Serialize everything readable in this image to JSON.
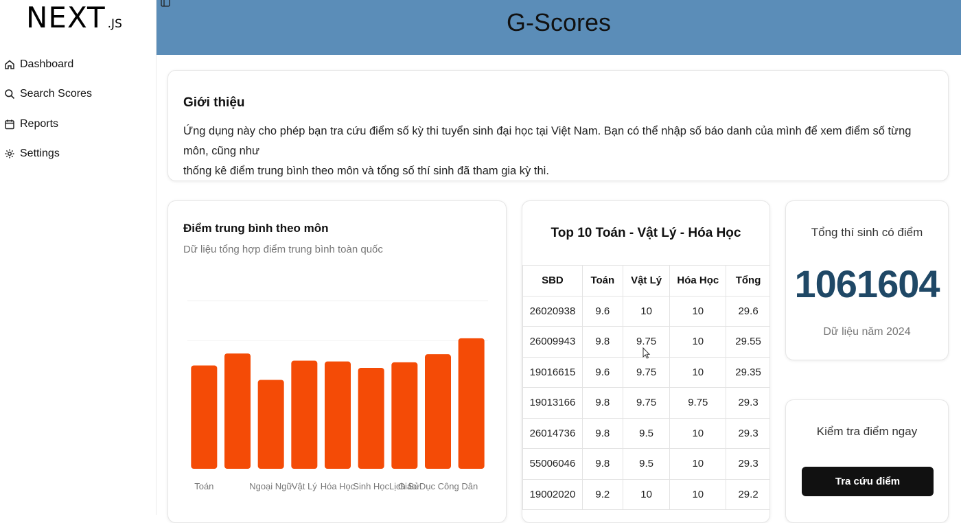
{
  "sidebar": {
    "logo": "NEXT",
    "logo_suffix": ".JS",
    "items": [
      {
        "label": "Dashboard",
        "icon": "home-icon"
      },
      {
        "label": "Search Scores",
        "icon": "search-icon"
      },
      {
        "label": "Reports",
        "icon": "calendar-icon"
      },
      {
        "label": "Settings",
        "icon": "gear-icon"
      }
    ]
  },
  "header": {
    "title": "G-Scores"
  },
  "intro": {
    "title": "Giới thiệu",
    "text_line1": "Ứng dụng này cho phép bạn tra cứu điểm số kỳ thi tuyển sinh đại học tại Việt Nam. Bạn có thể nhập số báo danh của mình để xem điểm số từng môn, cũng như",
    "text_line2": "thống kê điểm trung bình theo môn và tổng số thí sinh đã tham gia kỳ thi."
  },
  "chart_card": {
    "title": "Điểm trung bình theo môn",
    "subtitle": "Dữ liệu tổng hợp điểm trung bình toàn quốc"
  },
  "chart_data": {
    "type": "bar",
    "categories": [
      "Toán",
      "Ngữ Văn",
      "Ngoại Ngữ",
      "Vật Lý",
      "Hóa Học",
      "Sinh Học",
      "Lịch Sử",
      "Giáo Dục Công Dân"
    ],
    "visible_tick_labels": [
      "Toán",
      "",
      "Ngoại Ngữ",
      "Vật Lý",
      "Hóa Học",
      "Sinh Học",
      "Lịch Sử",
      "Giáo Dục Công Dân"
    ],
    "values": [
      6.45,
      7.2,
      5.55,
      6.75,
      6.7,
      6.3,
      6.65,
      7.15,
      8.15
    ],
    "ylim": [
      0,
      12
    ],
    "bar_color": "#f44b06",
    "grid": true,
    "title": "",
    "xlabel": "",
    "ylabel": ""
  },
  "top_table": {
    "title": "Top 10 Toán - Vật Lý - Hóa Học",
    "headers": [
      "SBD",
      "Toán",
      "Vật Lý",
      "Hóa Học",
      "Tổng"
    ],
    "rows": [
      [
        "26020938",
        "9.6",
        "10",
        "10",
        "29.6"
      ],
      [
        "26009943",
        "9.8",
        "9.75",
        "10",
        "29.55"
      ],
      [
        "19016615",
        "9.6",
        "9.75",
        "10",
        "29.35"
      ],
      [
        "19013166",
        "9.8",
        "9.75",
        "9.75",
        "29.3"
      ],
      [
        "26014736",
        "9.8",
        "9.5",
        "10",
        "29.3"
      ],
      [
        "55006046",
        "9.8",
        "9.5",
        "10",
        "29.3"
      ],
      [
        "19002020",
        "9.2",
        "10",
        "10",
        "29.2"
      ]
    ]
  },
  "total": {
    "label": "Tổng thí sinh có điểm",
    "value": "1061604",
    "year_note": "Dữ liệu năm 2024"
  },
  "check": {
    "label": "Kiểm tra điểm ngay",
    "button": "Tra cứu điểm"
  },
  "colors": {
    "header": "#5b8db8",
    "accent_number": "#1f4866",
    "bar": "#f44b06",
    "button": "#111111"
  }
}
